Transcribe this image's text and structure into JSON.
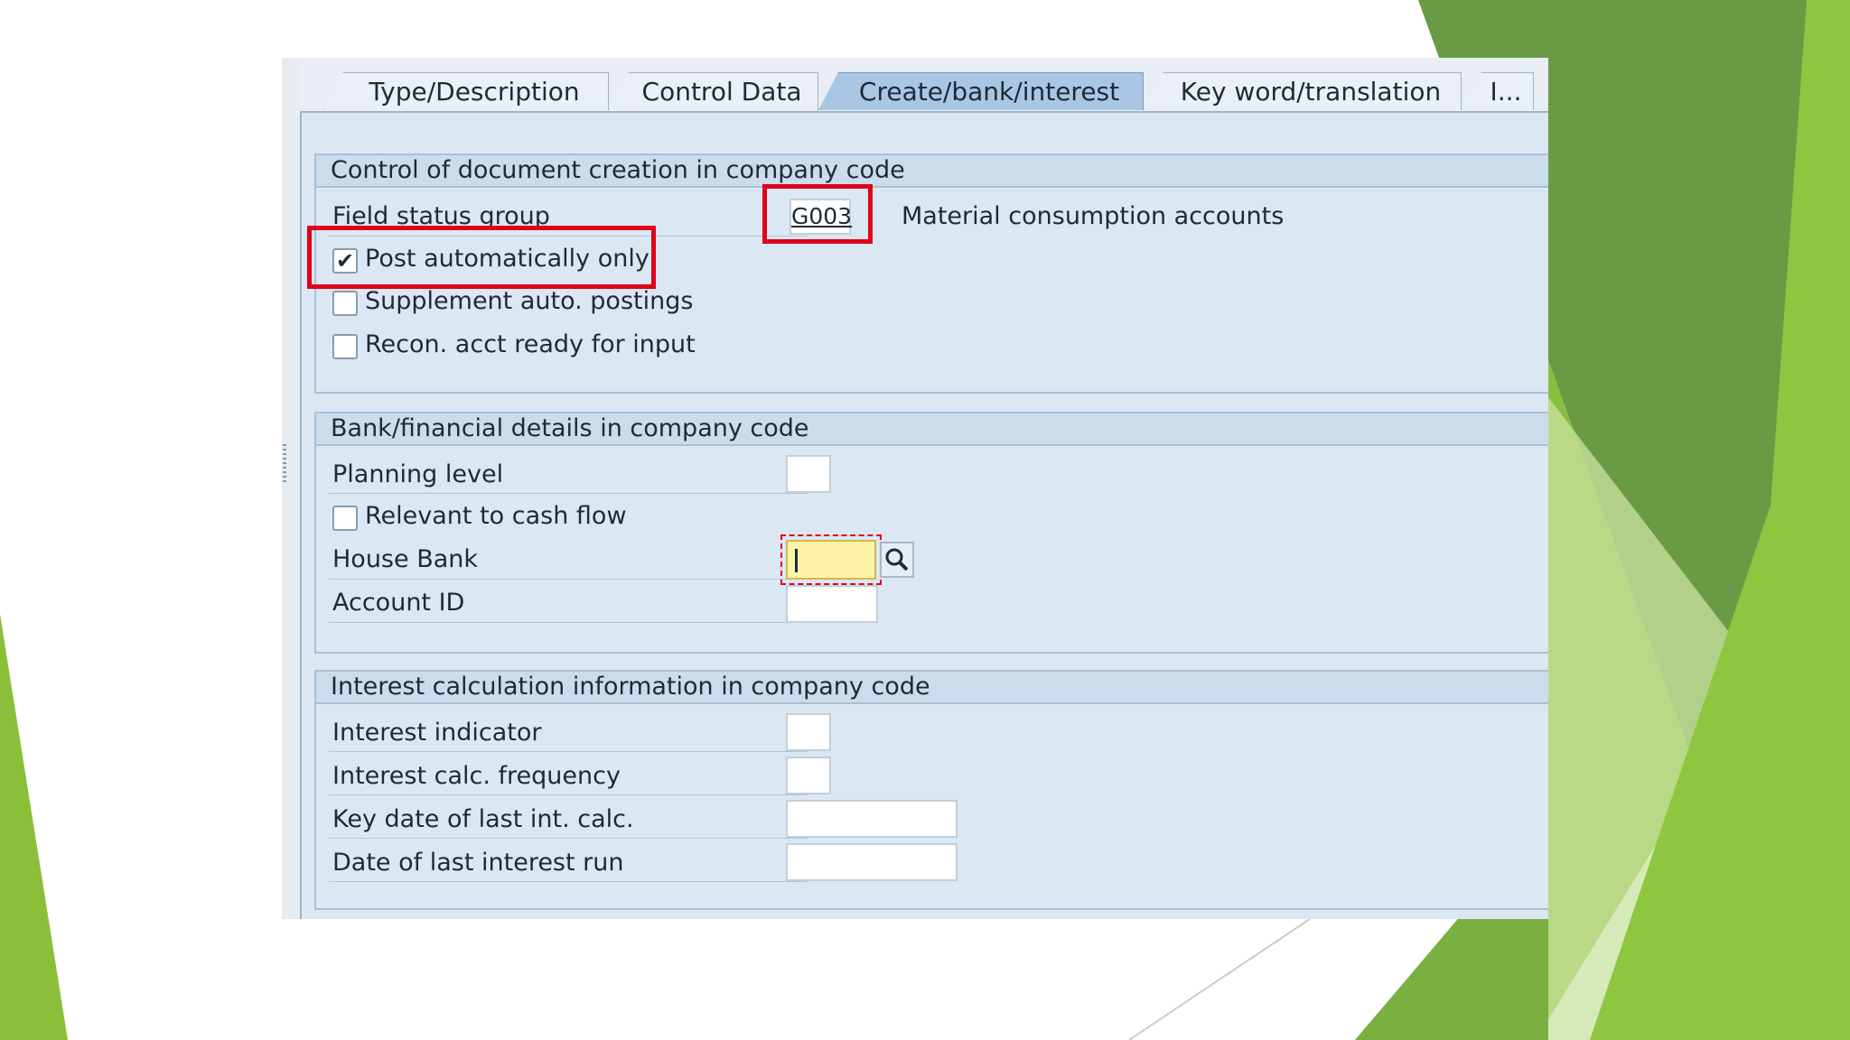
{
  "tabs": [
    {
      "label": "Type/Description",
      "active": false
    },
    {
      "label": "Control Data",
      "active": false
    },
    {
      "label": "Create/bank/interest",
      "active": true
    },
    {
      "label": "Key word/translation",
      "active": false
    },
    {
      "label": "I...",
      "active": false
    }
  ],
  "doc_creation": {
    "title": "Control of document creation in company code",
    "field_status_group_label": "Field status group",
    "field_status_group_value": "G003",
    "field_status_group_desc": "Material consumption accounts",
    "post_auto_only_label": "Post automatically only",
    "post_auto_only_checked": true,
    "supplement_label": "Supplement auto. postings",
    "supplement_checked": false,
    "recon_label": "Recon. acct ready for input",
    "recon_checked": false
  },
  "bank": {
    "title": "Bank/financial details in company code",
    "planning_level_label": "Planning level",
    "planning_level_value": "",
    "cash_flow_label": "Relevant to cash flow",
    "cash_flow_checked": false,
    "house_bank_label": "House Bank",
    "house_bank_value": "",
    "account_id_label": "Account ID",
    "account_id_value": ""
  },
  "interest": {
    "title": "Interest calculation information in company code",
    "indicator_label": "Interest indicator",
    "indicator_value": "",
    "frequency_label": "Interest calc. frequency",
    "frequency_value": "",
    "key_date_label": "Key date of last int. calc.",
    "key_date_value": "",
    "last_run_label": "Date of last interest run",
    "last_run_value": ""
  },
  "colors": {
    "highlight": "#e0001a",
    "focused_field": "#fff3a8",
    "active_tab": "#a9c6e3",
    "slide_green_dark": "#5f8f3a",
    "slide_green_light": "#8dc63f"
  },
  "icons": {
    "checkmark": "check-icon",
    "value_help": "magnifier-icon"
  }
}
